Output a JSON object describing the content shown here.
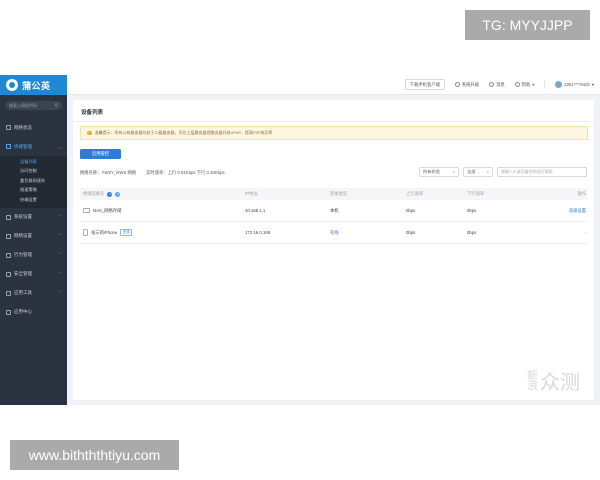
{
  "overlays": {
    "top_tag": "TG: MYYJJPP",
    "bottom_tag": "www.bithththtiyu.com"
  },
  "app": {
    "logo_text": "蒲公英",
    "sidebar": {
      "search_placeholder": "搜索入网权代码",
      "items": [
        {
          "label": "网络状态",
          "icon": "monitor-icon"
        },
        {
          "label": "终端管理",
          "icon": "devices-icon",
          "active": true
        },
        {
          "label": "系统设置",
          "icon": "settings-icon"
        },
        {
          "label": "网络设置",
          "icon": "network-icon"
        },
        {
          "label": "行为管理",
          "icon": "behavior-icon"
        },
        {
          "label": "安全管理",
          "icon": "shield-icon"
        },
        {
          "label": "应用工具",
          "icon": "tools-icon"
        },
        {
          "label": "应用中心",
          "icon": "apps-icon"
        }
      ],
      "sub_items": [
        "设备列表",
        "访问控制",
        "重负载网速失",
        "限速策略",
        "终端设置"
      ]
    },
    "topbar": {
      "download_client": "下载手机客户端",
      "upgrade": "系统升级",
      "messages": "消息",
      "help": "帮助",
      "user": "1351****9425"
    },
    "main": {
      "title": "设备列表",
      "notice": "温馨提示：所有公有路由器均处于二级路由器，可在上层路由器把路由器开启UPnP，提高P2P成功率",
      "primary_button": "启用管控",
      "network_name_label": "网络名称：",
      "network_name_value": "YWZY_NWS 网络",
      "speed_label": "实时速率：",
      "speed_value": "上行 0.61Kbps 下行 0.32Kbps",
      "filter_status": "所有状态",
      "filter_all": "全部",
      "search_placeholder": "请输入IP或设备名称进行搜索"
    },
    "table": {
      "headers": [
        "终端设备名",
        "IP地址",
        "连接类型",
        "上行速率",
        "下行速率",
        "操作"
      ],
      "header_badges": [
        "2",
        "1"
      ],
      "rows": [
        {
          "name": "NAS_网络存储",
          "icon": "computer-icon",
          "tag": "",
          "ip": "10.168.1.1",
          "type": "本机",
          "up": "0bps",
          "down": "0bps",
          "action": "高级设置"
        },
        {
          "name": "张三的iPhone",
          "icon": "phone-icon",
          "tag": "在线",
          "ip": "172.16.0.168",
          "type": "有线",
          "up": "0bps",
          "down": "0bps",
          "action": "-"
        }
      ]
    }
  },
  "watermark": {
    "small_top": "新",
    "small_bottom": "浪",
    "big": "众测"
  }
}
